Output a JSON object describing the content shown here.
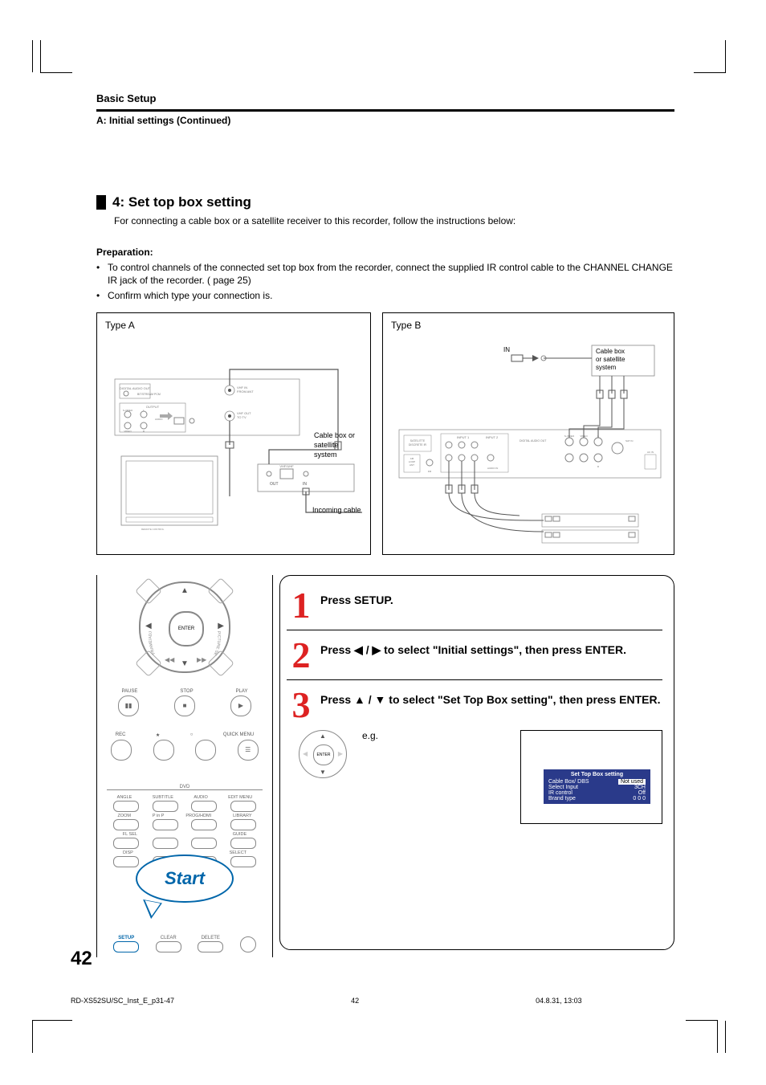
{
  "header": {
    "section": "Basic Setup",
    "subsection": "A: Initial settings (Continued)"
  },
  "heading": "4: Set top box setting",
  "intro": "For connecting a cable box or a satellite receiver to this recorder, follow the instructions below:",
  "prep_title": "Preparation:",
  "bullets": [
    "To control channels of the connected set top box from the recorder, connect the supplied IR control cable to the CHANNEL CHANGE IR jack of the recorder. (        page 25)",
    "Confirm which type your connection is."
  ],
  "diag_a": {
    "label": "Type A",
    "cable_box": "Cable box or satellite system",
    "out": "OUT",
    "in": "IN",
    "incoming": "Incoming cable",
    "vhf_in": "VHF IN\nFROM ANT",
    "vhf_out": "VHF OUT\nTO TV",
    "bitstream": "BITSTREAM\nPCM",
    "digital_out": "DIGITAL AUDIO OUT",
    "coax": "COAXIAL",
    "output": "OUTPUT",
    "svideo": "S-VIDEO",
    "video": "VIDEO",
    "l": "L",
    "r": "R",
    "audio": "AUDIO",
    "vhf_uhf": "VHF/UHF"
  },
  "diag_b": {
    "label": "Type B",
    "in": "IN",
    "cable_box": "Cable box or satellite system",
    "input1": "INPUT 1",
    "input2": "INPUT 2",
    "sat": "SATELITTE\nDISCRETE IR",
    "am": "AM\nLOOP\nANT",
    "fm": "FM\nANT 75Ω",
    "svideo": "S-VIDEO",
    "video": "VIDEO",
    "l": "L",
    "r": "R",
    "audio_in": "AUDIO IN",
    "ac_in": "AC IN",
    "digital_out": "DIGITAL AUDIO OUT"
  },
  "remote": {
    "enter": "ENTER",
    "frame_adjust": "FRAME/ADJUST",
    "picture_search": "PICTURE SEARCH",
    "row1": [
      "PAUSE",
      "STOP",
      "PLAY"
    ],
    "row2": [
      "REC",
      "",
      "",
      "QUICK MENU"
    ],
    "dvd": "DVD",
    "row3": [
      "ANGLE",
      "SUBTITLE",
      "AUDIO",
      "EDIT MENU"
    ],
    "row4": [
      "ZOOM",
      "P in P",
      "PROG/HDMI",
      "LIBRARY"
    ],
    "row5": [
      "FL SEL",
      "",
      "",
      "GUIDE"
    ],
    "row6": [
      "DISP",
      "",
      "",
      "SELECT"
    ],
    "row7": [
      "SETUP",
      "CLEAR",
      "DELETE",
      ""
    ],
    "start": "Start"
  },
  "steps": {
    "s1": "Press SETUP.",
    "s2": "Press ◀ / ▶ to select \"Initial settings\", then press ENTER.",
    "s3": "Press ▲ / ▼ to select \"Set Top Box setting\", then press ENTER.",
    "eg": "e.g.",
    "enter": "ENTER"
  },
  "osd": {
    "title": "Set Top Box setting",
    "rows": [
      {
        "key": "Cable Box/ DBS",
        "val": "Not used",
        "hl": true
      },
      {
        "key": "Select Input",
        "val": "3CH"
      },
      {
        "key": "IR control",
        "val": "Off"
      },
      {
        "key": "Brand type",
        "val": "0 0 0"
      }
    ]
  },
  "page_number": "42",
  "footer": {
    "file": "RD-XS52SU/SC_Inst_E_p31-47",
    "page": "42",
    "ts": "04.8.31, 13:03"
  }
}
